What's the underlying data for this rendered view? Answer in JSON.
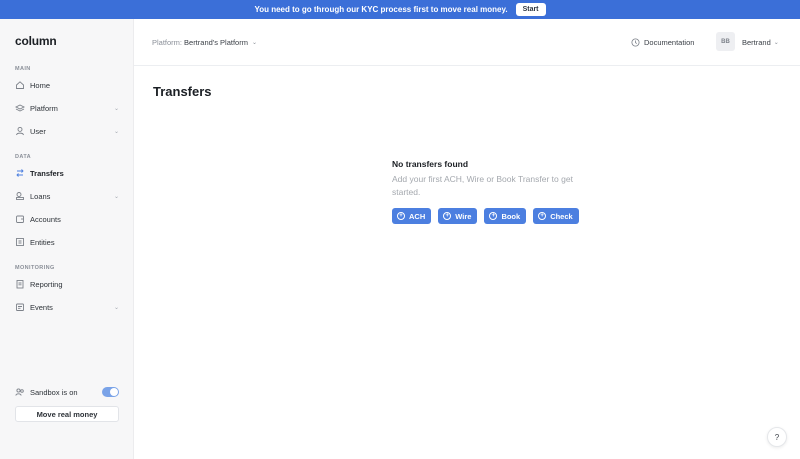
{
  "banner": {
    "text": "You need to go through our KYC process first to move real money.",
    "button": "Start"
  },
  "sidebar": {
    "logo": "column",
    "sections": {
      "main": "MAIN",
      "data": "DATA",
      "monitoring": "MONITORING"
    },
    "items": [
      {
        "label": "Home",
        "icon": "home-icon",
        "has_chevron": false
      },
      {
        "label": "Platform",
        "icon": "layers-icon",
        "has_chevron": true
      },
      {
        "label": "User",
        "icon": "user-icon",
        "has_chevron": true
      },
      {
        "label": "Transfers",
        "icon": "arrows-icon",
        "has_chevron": false,
        "active": true
      },
      {
        "label": "Loans",
        "icon": "coins-icon",
        "has_chevron": true
      },
      {
        "label": "Accounts",
        "icon": "wallet-icon",
        "has_chevron": false
      },
      {
        "label": "Entities",
        "icon": "building-icon",
        "has_chevron": false
      },
      {
        "label": "Reporting",
        "icon": "report-icon",
        "has_chevron": false
      },
      {
        "label": "Events",
        "icon": "events-icon",
        "has_chevron": true
      }
    ],
    "sandbox_label": "Sandbox is on",
    "sandbox_on": true,
    "move_money": "Move real money"
  },
  "header": {
    "platform_label": "Platform:",
    "platform_value": "Bertrand's Platform",
    "docs": "Documentation",
    "avatar_initials": "BB",
    "user_name": "Bertrand"
  },
  "main": {
    "title": "Transfers",
    "empty_title": "No transfers found",
    "empty_subtitle": "Add your first ACH, Wire or Book Transfer to get started.",
    "actions": [
      "ACH",
      "Wire",
      "Book",
      "Check"
    ]
  },
  "help": "?",
  "colors": {
    "accent": "#4c7fe0",
    "banner": "#3b6fd8"
  }
}
